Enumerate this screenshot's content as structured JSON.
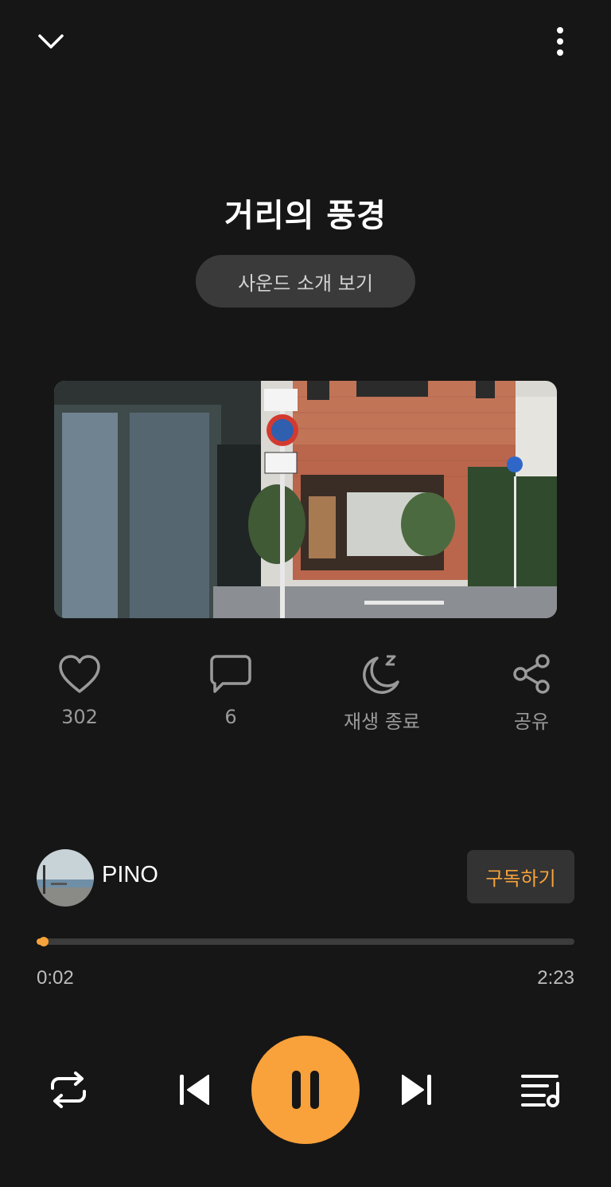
{
  "header": {
    "collapse_icon": "chevron-down-icon",
    "more_icon": "more-vertical-icon"
  },
  "track": {
    "title": "거리의 풍경",
    "intro_button_label": "사운드 소개 보기"
  },
  "actions": {
    "like": {
      "icon": "heart-icon",
      "label": "302"
    },
    "comment": {
      "icon": "comment-icon",
      "label": "6"
    },
    "sleep_timer": {
      "icon": "moon-sleep-icon",
      "label": "재생 종료"
    },
    "share": {
      "icon": "share-icon",
      "label": "공유"
    }
  },
  "artist": {
    "name": "PINO",
    "subscribe_label": "구독하기"
  },
  "playback": {
    "current_time": "0:02",
    "total_time": "2:23",
    "progress": 0.014,
    "state": "playing"
  },
  "controls": {
    "repeat_icon": "repeat-icon",
    "prev_icon": "skip-previous-icon",
    "play_pause_icon": "pause-icon",
    "next_icon": "skip-next-icon",
    "playlist_icon": "playlist-icon"
  },
  "colors": {
    "accent": "#f9a13a",
    "background": "#161616"
  }
}
